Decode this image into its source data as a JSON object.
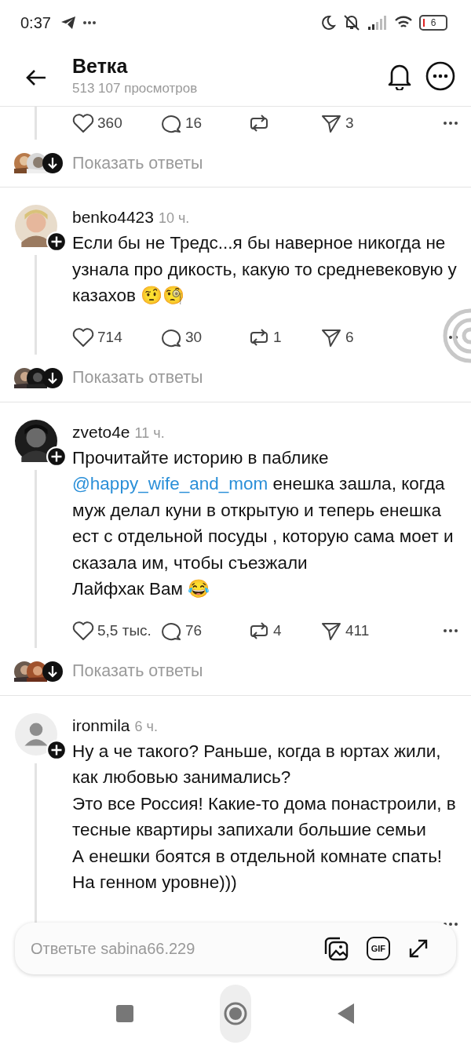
{
  "status_bar": {
    "time": "0:37",
    "battery": "6"
  },
  "header": {
    "title": "Ветка",
    "subtitle": "513 107 просмотров"
  },
  "previous_post": {
    "actions": [
      {
        "kind": "like",
        "count": "360"
      },
      {
        "kind": "reply",
        "count": "16"
      },
      {
        "kind": "repost"
      },
      {
        "kind": "share",
        "count": "3"
      }
    ],
    "show_replies": "Показать ответы"
  },
  "posts": [
    {
      "username": "benko4423",
      "time": "10 ч.",
      "avatar": {
        "kind": "picture"
      },
      "text": [
        {
          "kind": "text",
          "text": "Если бы не Тредс...я бы наверное никогда не узнала про дикость, какую то средневековую у казахов 🤨🧐"
        }
      ],
      "actions": [
        {
          "kind": "like",
          "count": "714"
        },
        {
          "kind": "reply",
          "count": "30"
        },
        {
          "kind": "repost",
          "count": "1"
        },
        {
          "kind": "share",
          "count": "6"
        }
      ],
      "show_replies": "Показать ответы"
    },
    {
      "username": "zveto4e",
      "time": "11 ч.",
      "avatar": {
        "kind": "picture"
      },
      "text": [
        {
          "kind": "text",
          "text": "Прочитайте историю в паблике "
        },
        {
          "kind": "mention",
          "text": "@happy_wife_and_mom"
        },
        {
          "kind": "text",
          "text": " енешка зашла, когда муж делал куни в открытую и теперь енешка ест с отдельной посуды , которую сама моет и сказала им, чтобы съезжали\nЛайфхак Вам 😂"
        }
      ],
      "actions": [
        {
          "kind": "like",
          "count": "5,5 тыс."
        },
        {
          "kind": "reply",
          "count": "76"
        },
        {
          "kind": "repost",
          "count": "4"
        },
        {
          "kind": "share",
          "count": "411"
        }
      ],
      "show_replies": "Показать ответы"
    },
    {
      "username": "ironmila",
      "time": "6 ч.",
      "avatar": {
        "kind": "placeholder"
      },
      "text": [
        {
          "kind": "text",
          "text": "Ну а че такого? Раньше, когда в юртах жили, как любовью занимались?\nЭто все Россия! Какие-то дома понастроили, в тесные квартиры запихали большие семьи\nА енешки боятся в отдельной комнате спать! На генном уровне)))"
        }
      ]
    }
  ],
  "composer": {
    "placeholder": "Ответьте sabina66.229",
    "gif_label": "GIF"
  }
}
